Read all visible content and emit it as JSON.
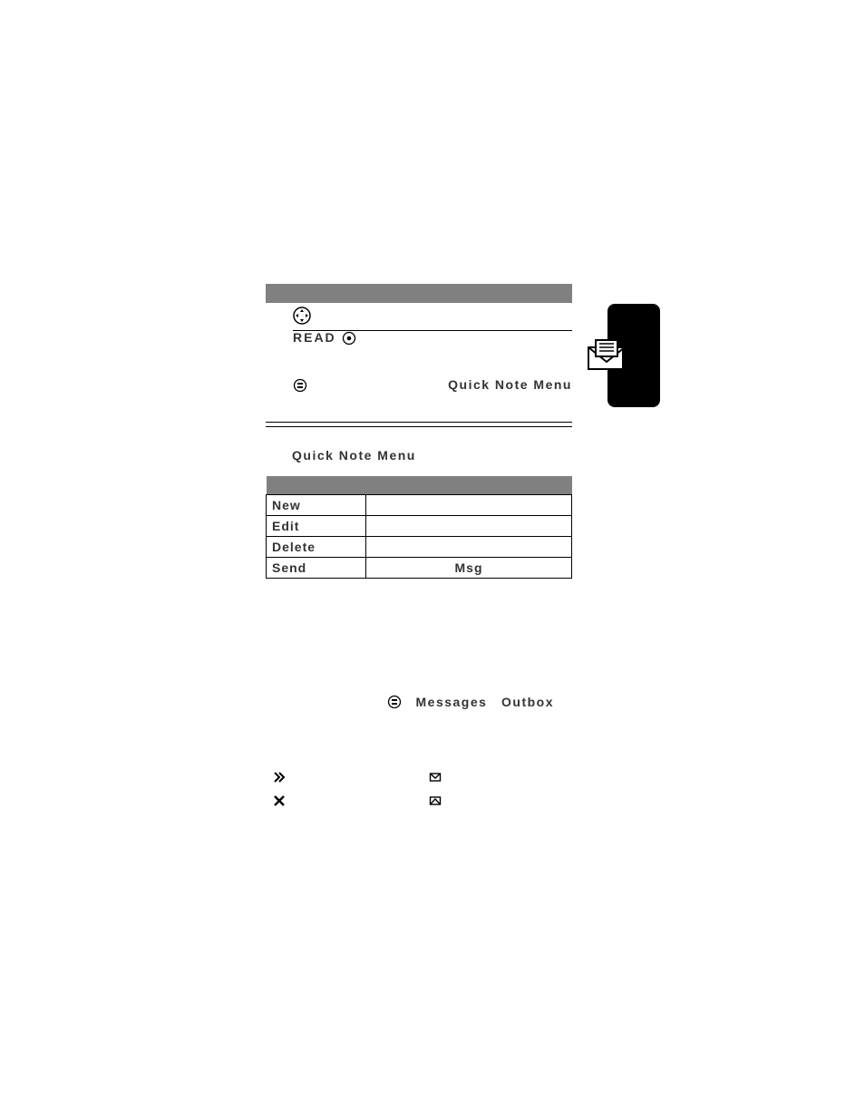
{
  "hdr": {
    "nav_step": "",
    "read_label": "READ",
    "menu_hint_left": "",
    "menu_hint_right": "Quick Note Menu"
  },
  "section": {
    "title": "Quick Note Menu"
  },
  "table": {
    "head_left": "",
    "head_right": "",
    "rows": [
      {
        "opt": "New",
        "desc": ""
      },
      {
        "opt": "Edit",
        "desc": ""
      },
      {
        "opt": "Delete",
        "desc": ""
      },
      {
        "opt": "Send",
        "desc": "Msg"
      }
    ]
  },
  "outbox": {
    "prefix": "",
    "menu1": "Messages",
    "menu2": "Outbox"
  },
  "legend": {
    "c1r1": "",
    "c1r2": "",
    "c2r1": "",
    "c2r2": ""
  }
}
